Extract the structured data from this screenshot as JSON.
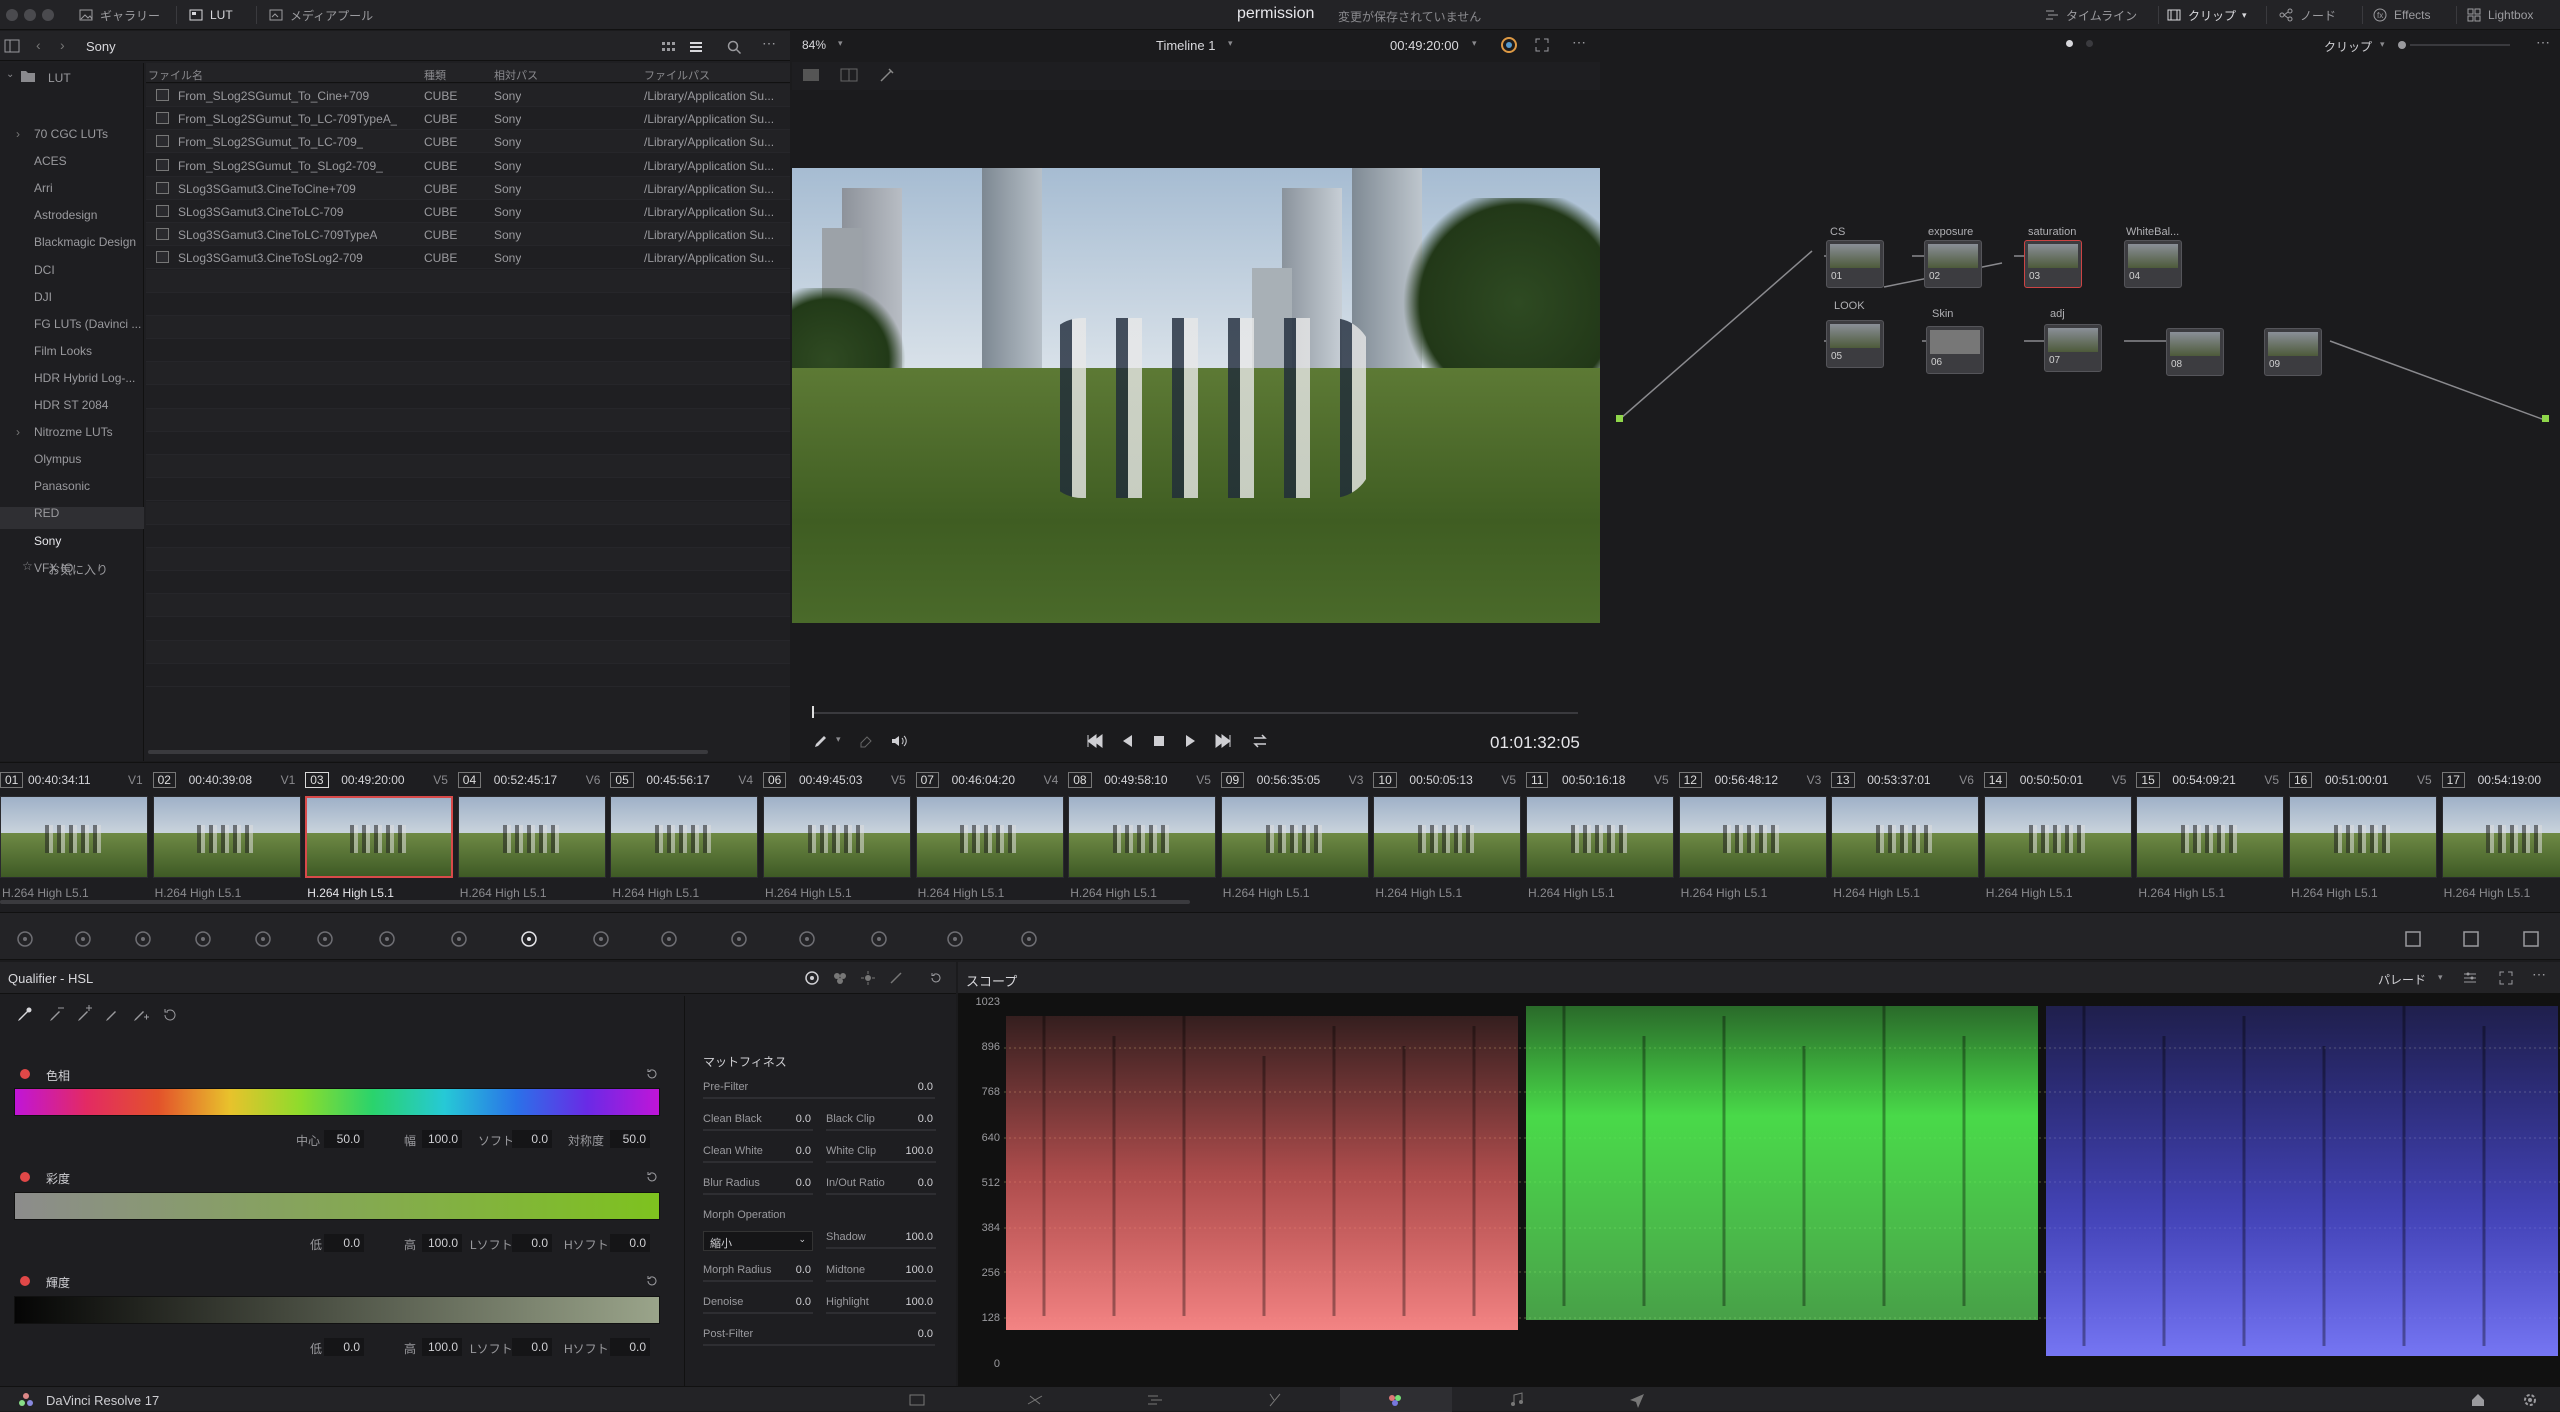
{
  "topbar": {
    "gallery": "ギャラリー",
    "lut": "LUT",
    "media_pool": "メディアプール",
    "project_title": "permission",
    "save_status": "変更が保存されていません",
    "timeline": "タイムライン",
    "clip": "クリップ",
    "node": "ノード",
    "effects": "Effects",
    "lightbox": "Lightbox"
  },
  "lut_browser": {
    "folder": "Sony",
    "root": "LUT",
    "items": [
      "70 CGC LUTs",
      "ACES",
      "Arri",
      "Astrodesign",
      "Blackmagic Design",
      "DCI",
      "DJI",
      "FG LUTs (Davinci ...",
      "Film Looks",
      "HDR Hybrid Log-...",
      "HDR ST 2084",
      "Nitrozme LUTs",
      "Olympus",
      "Panasonic",
      "RED",
      "Sony",
      "VFX IO"
    ],
    "favorites": "お気に入り",
    "columns": [
      "ファイル名",
      "種類",
      "相対パス",
      "ファイルパス"
    ],
    "files": [
      {
        "name": "From_SLog2SGumut_To_Cine+709",
        "type": "CUBE",
        "rel": "Sony",
        "path": "/Library/Application Su..."
      },
      {
        "name": "From_SLog2SGumut_To_LC-709TypeA_",
        "type": "CUBE",
        "rel": "Sony",
        "path": "/Library/Application Su..."
      },
      {
        "name": "From_SLog2SGumut_To_LC-709_",
        "type": "CUBE",
        "rel": "Sony",
        "path": "/Library/Application Su..."
      },
      {
        "name": "From_SLog2SGumut_To_SLog2-709_",
        "type": "CUBE",
        "rel": "Sony",
        "path": "/Library/Application Su..."
      },
      {
        "name": "SLog3SGamut3.CineToCine+709",
        "type": "CUBE",
        "rel": "Sony",
        "path": "/Library/Application Su..."
      },
      {
        "name": "SLog3SGamut3.CineToLC-709",
        "type": "CUBE",
        "rel": "Sony",
        "path": "/Library/Application Su..."
      },
      {
        "name": "SLog3SGamut3.CineToLC-709TypeA",
        "type": "CUBE",
        "rel": "Sony",
        "path": "/Library/Application Su..."
      },
      {
        "name": "SLog3SGamut3.CineToSLog2-709",
        "type": "CUBE",
        "rel": "Sony",
        "path": "/Library/Application Su..."
      }
    ]
  },
  "viewer": {
    "zoom": "84%",
    "timeline_name": "Timeline 1",
    "timecode_top": "00:49:20:00",
    "timecode": "01:01:32:05"
  },
  "nodes": {
    "labels": [
      "CS",
      "exposure",
      "saturation",
      "WhiteBal...",
      "LOOK",
      "Skin",
      "adj"
    ],
    "numbers": [
      "01",
      "02",
      "03",
      "04",
      "05",
      "06",
      "07",
      "08",
      "09"
    ],
    "clip_mode": "クリップ"
  },
  "clips": [
    {
      "num": "01",
      "tc": "00:40:34:11",
      "track": "V1"
    },
    {
      "num": "02",
      "tc": "00:40:39:08",
      "track": "V1"
    },
    {
      "num": "03",
      "tc": "00:49:20:00",
      "track": "V5"
    },
    {
      "num": "04",
      "tc": "00:52:45:17",
      "track": "V6"
    },
    {
      "num": "05",
      "tc": "00:45:56:17",
      "track": "V4"
    },
    {
      "num": "06",
      "tc": "00:49:45:03",
      "track": "V5"
    },
    {
      "num": "07",
      "tc": "00:46:04:20",
      "track": "V4"
    },
    {
      "num": "08",
      "tc": "00:49:58:10",
      "track": "V5"
    },
    {
      "num": "09",
      "tc": "00:56:35:05",
      "track": "V3"
    },
    {
      "num": "10",
      "tc": "00:50:05:13",
      "track": "V5"
    },
    {
      "num": "11",
      "tc": "00:50:16:18",
      "track": "V5"
    },
    {
      "num": "12",
      "tc": "00:56:48:12",
      "track": "V3"
    },
    {
      "num": "13",
      "tc": "00:53:37:01",
      "track": "V6"
    },
    {
      "num": "14",
      "tc": "00:50:50:01",
      "track": "V5"
    },
    {
      "num": "15",
      "tc": "00:54:09:21",
      "track": "V5"
    },
    {
      "num": "16",
      "tc": "00:51:00:01",
      "track": "V5"
    },
    {
      "num": "17",
      "tc": "00:54:19:00",
      "track": ""
    }
  ],
  "clip_codec": "H.264 High L5.1",
  "qualifier": {
    "title": "Qualifier - HSL",
    "hue": {
      "label": "色相",
      "center_label": "中心",
      "center": "50.0",
      "width_label": "幅",
      "width": "100.0",
      "soft_label": "ソフト",
      "soft": "0.0",
      "sym_label": "対称度",
      "sym": "50.0"
    },
    "sat": {
      "label": "彩度",
      "low_label": "低",
      "low": "0.0",
      "high_label": "高",
      "high": "100.0",
      "lsoft_label": "Lソフト",
      "lsoft": "0.0",
      "hsoft_label": "Hソフト",
      "hsoft": "0.0"
    },
    "lum": {
      "label": "輝度",
      "low_label": "低",
      "low": "0.0",
      "high_label": "高",
      "high": "100.0",
      "lsoft_label": "Lソフト",
      "lsoft": "0.0",
      "hsoft_label": "Hソフト",
      "hsoft": "0.0"
    }
  },
  "matte_finesse": {
    "title": "マットフィネス",
    "prefilter": "Pre-Filter",
    "prefilter_v": "0.0",
    "clean_black": "Clean Black",
    "clean_black_v": "0.0",
    "black_clip": "Black Clip",
    "black_clip_v": "0.0",
    "clean_white": "Clean White",
    "clean_white_v": "0.0",
    "white_clip": "White Clip",
    "white_clip_v": "100.0",
    "blur_radius": "Blur Radius",
    "blur_radius_v": "0.0",
    "inout_ratio": "In/Out Ratio",
    "inout_ratio_v": "0.0",
    "morph_op": "Morph Operation",
    "morph_select": "縮小",
    "shadow": "Shadow",
    "shadow_v": "100.0",
    "morph_radius": "Morph Radius",
    "morph_radius_v": "0.0",
    "midtone": "Midtone",
    "midtone_v": "100.0",
    "denoise": "Denoise",
    "denoise_v": "0.0",
    "highlight": "Highlight",
    "highlight_v": "100.0",
    "postfilter": "Post-Filter",
    "postfilter_v": "0.0"
  },
  "scope": {
    "title": "スコープ",
    "mode": "パレード",
    "scale": [
      "1023",
      "896",
      "768",
      "640",
      "512",
      "384",
      "256",
      "128",
      "0"
    ]
  },
  "footer": {
    "app": "DaVinci Resolve 17"
  }
}
